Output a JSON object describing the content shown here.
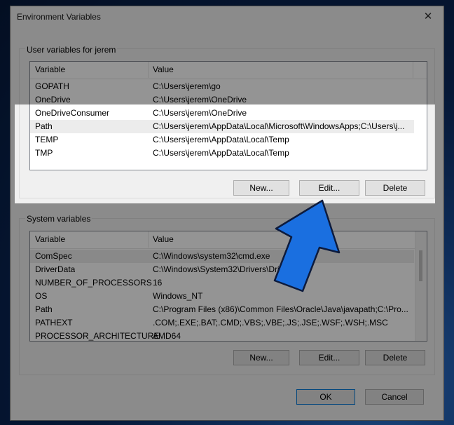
{
  "window": {
    "title": "Environment Variables",
    "close_glyph": "✕"
  },
  "user_vars": {
    "label": "User variables for jerem",
    "columns": [
      "Variable",
      "Value"
    ],
    "rows": [
      {
        "variable": "GOPATH",
        "value": "C:\\Users\\jerem\\go"
      },
      {
        "variable": "OneDrive",
        "value": "C:\\Users\\jerem\\OneDrive"
      },
      {
        "variable": "OneDriveConsumer",
        "value": "C:\\Users\\jerem\\OneDrive"
      },
      {
        "variable": "Path",
        "value": "C:\\Users\\jerem\\AppData\\Local\\Microsoft\\WindowsApps;C:\\Users\\j..."
      },
      {
        "variable": "TEMP",
        "value": "C:\\Users\\jerem\\AppData\\Local\\Temp"
      },
      {
        "variable": "TMP",
        "value": "C:\\Users\\jerem\\AppData\\Local\\Temp"
      }
    ],
    "buttons": {
      "new": "New...",
      "edit": "Edit...",
      "delete": "Delete"
    }
  },
  "system_vars": {
    "label": "System variables",
    "columns": [
      "Variable",
      "Value"
    ],
    "rows": [
      {
        "variable": "ComSpec",
        "value": "C:\\Windows\\system32\\cmd.exe"
      },
      {
        "variable": "DriverData",
        "value": "C:\\Windows\\System32\\Drivers\\DriverData"
      },
      {
        "variable": "NUMBER_OF_PROCESSORS",
        "value": "16"
      },
      {
        "variable": "OS",
        "value": "Windows_NT"
      },
      {
        "variable": "Path",
        "value": "C:\\Program Files (x86)\\Common Files\\Oracle\\Java\\javapath;C:\\Pro..."
      },
      {
        "variable": "PATHEXT",
        "value": ".COM;.EXE;.BAT;.CMD;.VBS;.VBE;.JS;.JSE;.WSF;.WSH;.MSC"
      },
      {
        "variable": "PROCESSOR_ARCHITECTURE",
        "value": "AMD64"
      }
    ],
    "buttons": {
      "new": "New...",
      "edit": "Edit...",
      "delete": "Delete"
    }
  },
  "footer": {
    "ok": "OK",
    "cancel": "Cancel"
  },
  "colors": {
    "highlight_arrow": "#1a6fe0",
    "arrow_outline": "#0d1b3d",
    "dim_overlay": "#000000"
  }
}
